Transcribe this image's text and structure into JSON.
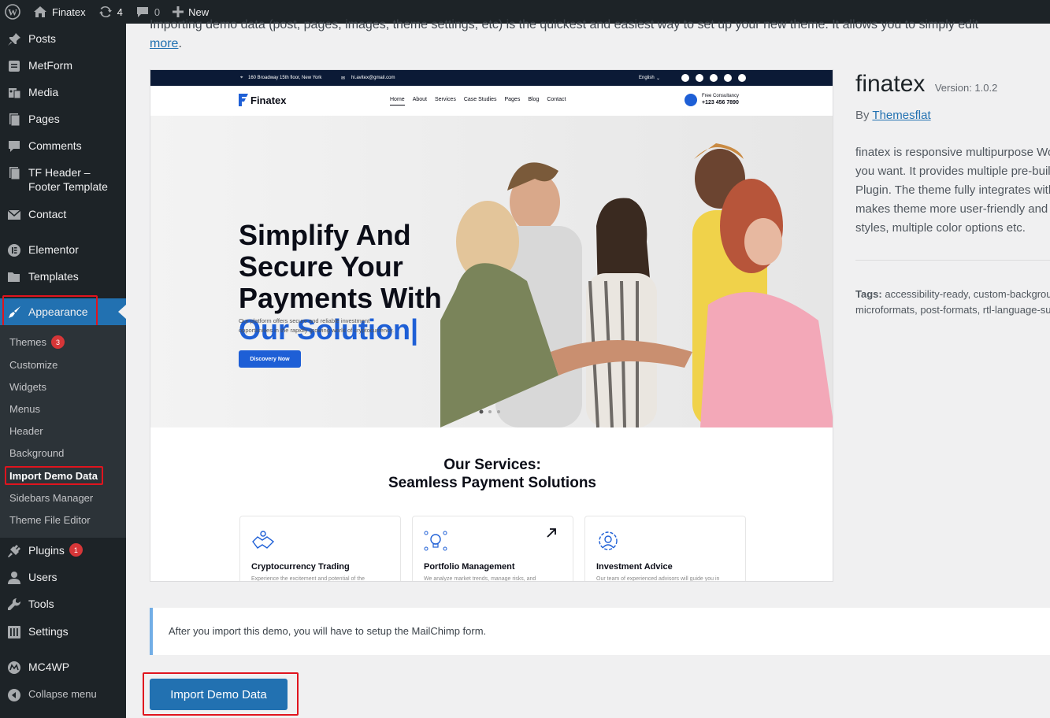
{
  "adminbar": {
    "site_name": "Finatex",
    "updates_count": "4",
    "comments_count": "0",
    "new_label": "New"
  },
  "sidebar": {
    "items": [
      {
        "label": "Posts",
        "icon": "pin-icon"
      },
      {
        "label": "MetForm",
        "icon": "form-icon"
      },
      {
        "label": "Media",
        "icon": "media-icon"
      },
      {
        "label": "Pages",
        "icon": "pages-icon"
      },
      {
        "label": "Comments",
        "icon": "comments-icon"
      },
      {
        "label": "TF Header –",
        "label2": "Footer Template",
        "icon": "pages-icon"
      },
      {
        "label": "Contact",
        "icon": "email-icon"
      },
      {
        "label": "Elementor",
        "icon": "elementor-icon"
      },
      {
        "label": "Templates",
        "icon": "folder-icon"
      },
      {
        "label": "Appearance",
        "icon": "brush-icon"
      }
    ],
    "submenu": [
      {
        "label": "Themes",
        "badge": "3"
      },
      {
        "label": "Customize"
      },
      {
        "label": "Widgets"
      },
      {
        "label": "Menus"
      },
      {
        "label": "Header"
      },
      {
        "label": "Background"
      },
      {
        "label": "Import Demo Data"
      },
      {
        "label": "Sidebars Manager"
      },
      {
        "label": "Theme File Editor"
      }
    ],
    "bottom_items": [
      {
        "label": "Plugins",
        "badge": "1",
        "icon": "plugin-icon"
      },
      {
        "label": "Users",
        "icon": "users-icon"
      },
      {
        "label": "Tools",
        "icon": "wrench-icon"
      },
      {
        "label": "Settings",
        "icon": "settings-icon"
      },
      {
        "label": "MC4WP",
        "icon": "mc4wp-icon"
      },
      {
        "label": "Collapse menu",
        "icon": "collapse-icon"
      }
    ]
  },
  "main": {
    "top_text": "Importing demo data (post, pages, images, theme settings, etc) is the quickest and easiest way to set up your new theme. It allows you to simply edit",
    "more_link": "more",
    "screenshot": {
      "address": "160 Broadway 15th floor, New York",
      "email": "hi.avitex@gmail.com",
      "language": "English",
      "logo": "Finatex",
      "nav": [
        "Home",
        "About",
        "Services",
        "Case Studies",
        "Pages",
        "Blog",
        "Contact"
      ],
      "consult_label": "Free Consultancy",
      "consult_phone": "+123 456 7890",
      "hero_line1": "Simplify And",
      "hero_line2": "Secure Your",
      "hero_line3": "Payments With",
      "hero_line4": "Our Solution",
      "hero_sub1": "Our platform offers secure and reliable investment",
      "hero_sub2": "opportunities in the rapidly growing world of cryptocurrency.",
      "hero_button": "Discovery Now",
      "services_title1": "Our Services:",
      "services_title2": "Seamless Payment Solutions",
      "cards": [
        {
          "title": "Cryptocurrency Trading",
          "desc": "Experience the excitement and potential of the"
        },
        {
          "title": "Portfolio Management",
          "desc": "We analyze market trends, manage risks, and"
        },
        {
          "title": "Investment Advice",
          "desc": "Our team of experienced advisors will guide you in"
        }
      ]
    },
    "theme": {
      "name": "finatex",
      "version": "Version: 1.0.2",
      "by": "By",
      "author": "Themesflat",
      "desc_lines": [
        "finatex is responsive multipurpose WordPress",
        "you want. It provides multiple pre-built",
        "Plugin. The theme fully integrates with",
        "makes theme more user-friendly and",
        "styles, multiple color options etc."
      ],
      "tags_label": "Tags:",
      "tags_line1": "accessibility-ready, custom-background",
      "tags_line2": "microformats, post-formats, rtl-language-support"
    },
    "notice": "After you import this demo, you will have to setup the MailChimp form.",
    "import_button": "Import Demo Data"
  },
  "colors": {
    "admin_dark": "#1d2327",
    "wp_blue": "#2271b1",
    "highlight_red": "#e0141e",
    "hero_blue": "#1e5fd6"
  }
}
